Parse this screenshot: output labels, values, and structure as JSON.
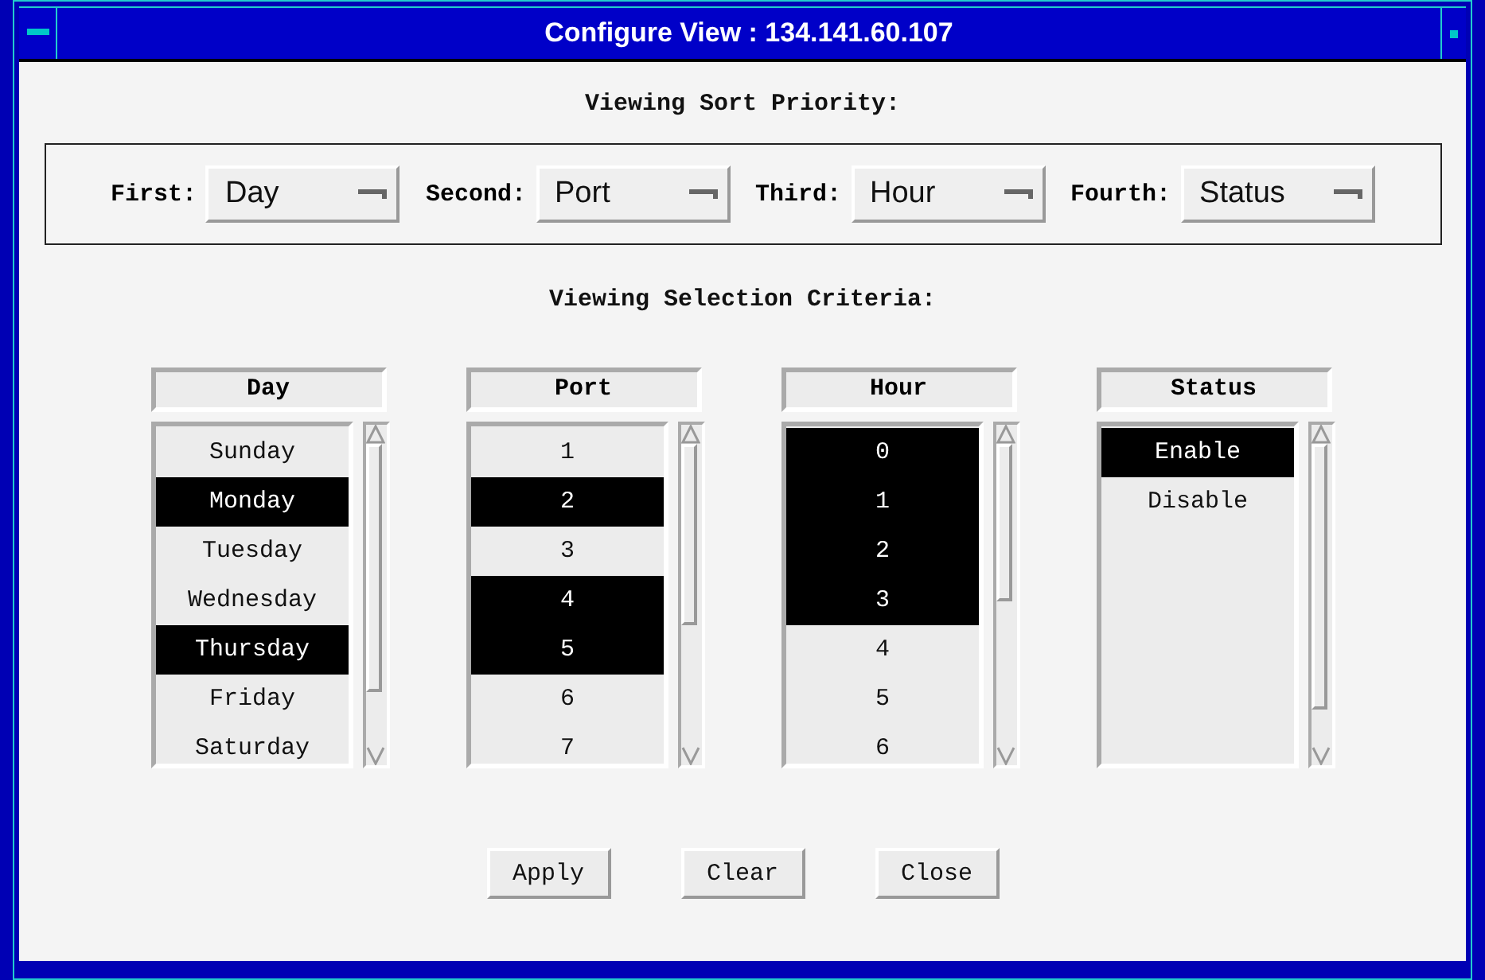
{
  "window": {
    "title": "Configure View : 134.141.60.107"
  },
  "sort_priority": {
    "heading": "Viewing Sort Priority:",
    "fields": [
      {
        "label": "First:",
        "value": "Day"
      },
      {
        "label": "Second:",
        "value": "Port"
      },
      {
        "label": "Third:",
        "value": "Hour"
      },
      {
        "label": "Fourth:",
        "value": "Status"
      }
    ]
  },
  "selection_criteria": {
    "heading": "Viewing Selection Criteria:",
    "lists": [
      {
        "header": "Day",
        "items": [
          {
            "label": "Sunday",
            "selected": false
          },
          {
            "label": "Monday",
            "selected": true
          },
          {
            "label": "Tuesday",
            "selected": false
          },
          {
            "label": "Wednesday",
            "selected": false
          },
          {
            "label": "Thursday",
            "selected": true
          },
          {
            "label": "Friday",
            "selected": false
          },
          {
            "label": "Saturday",
            "selected": false
          }
        ]
      },
      {
        "header": "Port",
        "items": [
          {
            "label": "1",
            "selected": false
          },
          {
            "label": "2",
            "selected": true
          },
          {
            "label": "3",
            "selected": false
          },
          {
            "label": "4",
            "selected": true
          },
          {
            "label": "5",
            "selected": true
          },
          {
            "label": "6",
            "selected": false
          },
          {
            "label": "7",
            "selected": false
          }
        ]
      },
      {
        "header": "Hour",
        "items": [
          {
            "label": "0",
            "selected": true
          },
          {
            "label": "1",
            "selected": true
          },
          {
            "label": "2",
            "selected": true
          },
          {
            "label": "3",
            "selected": true
          },
          {
            "label": "4",
            "selected": false
          },
          {
            "label": "5",
            "selected": false
          },
          {
            "label": "6",
            "selected": false
          }
        ]
      },
      {
        "header": "Status",
        "items": [
          {
            "label": "Enable",
            "selected": true
          },
          {
            "label": "Disable",
            "selected": false
          }
        ]
      }
    ]
  },
  "buttons": [
    "Apply",
    "Clear",
    "Close"
  ]
}
